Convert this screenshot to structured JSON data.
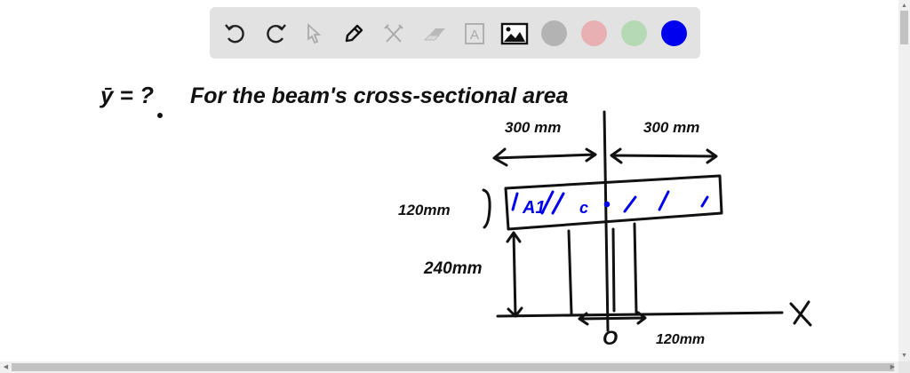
{
  "toolbar": {
    "tools": [
      {
        "name": "undo-icon",
        "enabled": true
      },
      {
        "name": "redo-icon",
        "enabled": true
      },
      {
        "name": "select-icon",
        "enabled": false
      },
      {
        "name": "pen-icon",
        "enabled": true
      },
      {
        "name": "tools-icon",
        "enabled": false
      },
      {
        "name": "eraser-icon",
        "enabled": false
      },
      {
        "name": "text-icon",
        "enabled": false
      },
      {
        "name": "image-icon",
        "enabled": true
      }
    ],
    "text_tool_glyph": "A",
    "colors": [
      "#b3b3b3",
      "#e8b0b3",
      "#b5d9b5",
      "#0000ee"
    ],
    "selected_color": "#0000ee"
  },
  "drawing": {
    "question": "ȳ = ?",
    "question_rest": "For the beam's cross-sectional area",
    "dim_left_top": "300 mm",
    "dim_right_top": "300 mm",
    "dim_flange": "120mm",
    "dim_web_height": "240mm",
    "area_label": "A1",
    "centroid_label": "c",
    "origin_label": "O",
    "dim_web_width": "120mm",
    "axis_label": "X",
    "ink_color": "#111111",
    "blue_ink": "#0000ee"
  }
}
